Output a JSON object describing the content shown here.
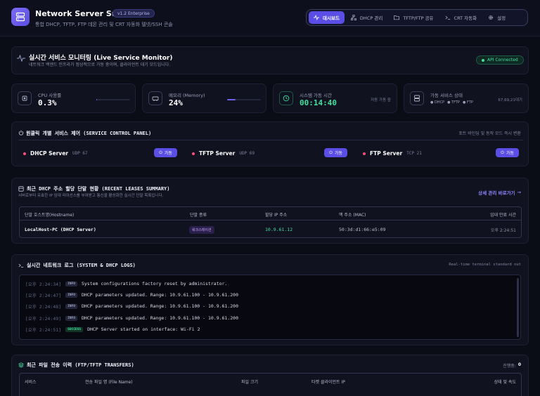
{
  "header": {
    "app_title": "Network Server Suite",
    "version": "v1.2 Enterprise",
    "subtitle": "통합 DHCP, TFTP, FTP 데몬 관리 및 CRT 자동화 텔넷/SSH 콘솔",
    "nav": [
      {
        "label": "대시보드",
        "icon": "pulse-icon",
        "active": true
      },
      {
        "label": "DHCP 관리",
        "icon": "network-icon"
      },
      {
        "label": "TFTP/FTP 공유",
        "icon": "folder-icon"
      },
      {
        "label": "CRT 자동화",
        "icon": "terminal-icon"
      },
      {
        "label": "설정",
        "icon": "gear-icon"
      }
    ]
  },
  "monitor": {
    "title": "실시간 서비스 모니터링 (Live Service Monitor)",
    "subtitle": "네트워크 백엔드 인프라가 정상적으로 가동 중이며, 클라이언트 대기 모드입니다.",
    "api_status": "API Connected"
  },
  "stats": {
    "cpu": {
      "label": "CPU 사용률",
      "value": "0.3%",
      "level": 0.003
    },
    "memory": {
      "label": "메모리 (Memory)",
      "value": "24%",
      "level": 0.24
    },
    "uptime": {
      "label": "시스템 가동 시간",
      "value": "00:14:40",
      "note": "자동 가동 중"
    },
    "services": {
      "label": "가동 서비스 상태",
      "items": [
        "DHCP",
        "TFTP",
        "FTP"
      ],
      "note": "67,69,21대기"
    }
  },
  "control": {
    "title": "원클릭 개별 서비스 제어 (SERVICE CONTROL PANEL)",
    "note": "포트 바인딩 및 동작 모드 즉시 변환",
    "services": [
      {
        "name": "DHCP Server",
        "port": "UDP 67",
        "button": "가동"
      },
      {
        "name": "TFTP Server",
        "port": "UDP 69",
        "button": "가동"
      },
      {
        "name": "FTP Server",
        "port": "TCP 21",
        "button": "가동"
      }
    ]
  },
  "leases": {
    "title": "최근 DHCP 주소 할당 단말 현황 (RECENT LEASES SUMMARY)",
    "subtitle": "서버로부터 유효한 IP 임대 라이선스를 부여받고 통신을 활성화한 실시간 단말 목록입니다.",
    "link": "상세 관리 바로가기",
    "columns": [
      "단말 호스트명(Hostname)",
      "단말 종류",
      "할당 IP 주소",
      "맥 주소 (MAC)",
      "임대 만료 시간"
    ],
    "rows": [
      {
        "hostname": "LocalHost-PC (DHCP Server)",
        "type": "워크스테이션",
        "ip": "10.9.61.12",
        "mac": "50:3d:d1:66:e5:09",
        "expires": "오후 2:24:51"
      }
    ]
  },
  "logs": {
    "title": "실시간 네트워크 로그 (SYSTEM & DHCP LOGS)",
    "note": "Real-time terminal standard out",
    "lines": [
      {
        "time": "[오후 2:24:34]",
        "tag": "INFO",
        "msg": "System configurations factory reset by administrator."
      },
      {
        "time": "[오후 2:24:47]",
        "tag": "INFO",
        "msg": "DHCP parameters updated. Range: 10.9.61.100 - 10.9.61.200"
      },
      {
        "time": "[오후 2:24:48]",
        "tag": "INFO",
        "msg": "DHCP parameters updated. Range: 10.9.61.100 - 10.9.61.200"
      },
      {
        "time": "[오후 2:24:49]",
        "tag": "INFO",
        "msg": "DHCP parameters updated. Range: 10.9.61.100 - 10.9.61.200"
      },
      {
        "time": "[오후 2:24:51]",
        "tag": "SUCCESS",
        "msg": "DHCP Server started on interface: Wi-Fi 2"
      }
    ]
  },
  "transfers": {
    "title": "최근 파일 전송 이력 (FTP/TFTP TRANSFERS)",
    "progress_label": "진행중:",
    "progress_count": "0",
    "columns": [
      "서비스",
      "전송 파일 명 (File Name)",
      "파일 크기",
      "타켓 클라이언트 IP",
      "상태 및 속도"
    ]
  }
}
